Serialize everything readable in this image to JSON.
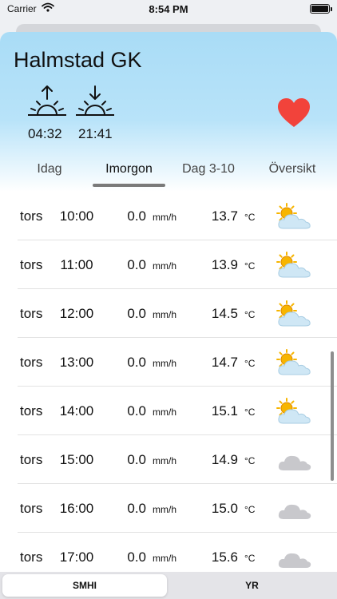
{
  "status_bar": {
    "carrier": "Carrier",
    "time": "8:54 PM"
  },
  "header": {
    "title": "Halmstad GK",
    "sunrise": "04:32",
    "sunset": "21:41"
  },
  "tabs": [
    {
      "label": "Idag",
      "active": false
    },
    {
      "label": "Imorgon",
      "active": true
    },
    {
      "label": "Dag 3-10",
      "active": false
    },
    {
      "label": "Översikt",
      "active": false
    }
  ],
  "units": {
    "precipitation": "mm/h",
    "temperature": "°C"
  },
  "rows": [
    {
      "day": "tors",
      "hour": "10:00",
      "precip": "0.0",
      "temp": "13.7",
      "icon": "partly-cloudy-icon"
    },
    {
      "day": "tors",
      "hour": "11:00",
      "precip": "0.0",
      "temp": "13.9",
      "icon": "partly-cloudy-icon"
    },
    {
      "day": "tors",
      "hour": "12:00",
      "precip": "0.0",
      "temp": "14.5",
      "icon": "partly-cloudy-icon"
    },
    {
      "day": "tors",
      "hour": "13:00",
      "precip": "0.0",
      "temp": "14.7",
      "icon": "partly-cloudy-icon"
    },
    {
      "day": "tors",
      "hour": "14:00",
      "precip": "0.0",
      "temp": "15.1",
      "icon": "partly-cloudy-icon"
    },
    {
      "day": "tors",
      "hour": "15:00",
      "precip": "0.0",
      "temp": "14.9",
      "icon": "cloud-icon"
    },
    {
      "day": "tors",
      "hour": "16:00",
      "precip": "0.0",
      "temp": "15.0",
      "icon": "cloud-icon"
    },
    {
      "day": "tors",
      "hour": "17:00",
      "precip": "0.0",
      "temp": "15.6",
      "icon": "cloud-icon"
    }
  ],
  "source_selector": {
    "options": [
      "SMHI",
      "YR"
    ],
    "selected": "SMHI"
  },
  "colors": {
    "header_sky": "#a9dcf6",
    "heart": "#f2433b",
    "sun": "#f7b500",
    "cloud": "#c8c8cc"
  }
}
